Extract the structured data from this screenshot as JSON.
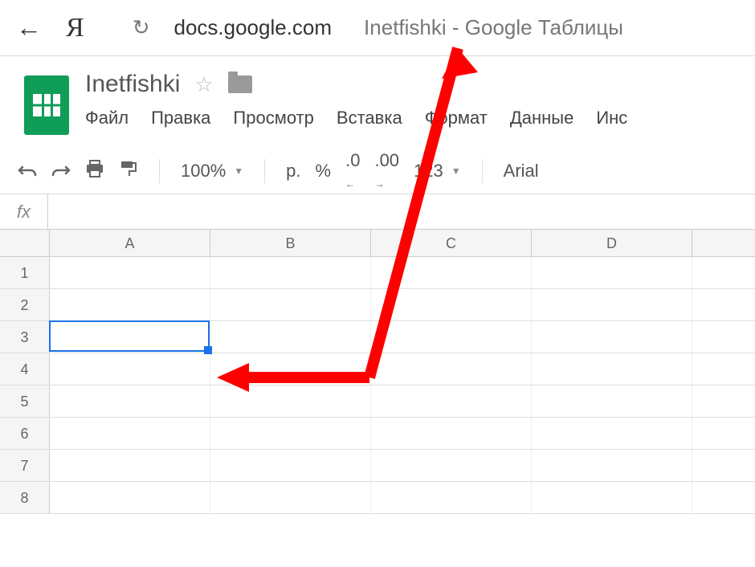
{
  "browser": {
    "back_icon": "←",
    "yandex_icon": "Я",
    "reload_icon": "↻",
    "url_domain": "docs.google.com",
    "url_title": "Inetfishki - Google Таблицы"
  },
  "doc": {
    "title": "Inetfishki",
    "star": "☆"
  },
  "menu": {
    "file": "Файл",
    "edit": "Правка",
    "view": "Просмотр",
    "insert": "Вставка",
    "format": "Формат",
    "data": "Данные",
    "tools": "Инс"
  },
  "toolbar": {
    "undo": "↶",
    "redo": "↷",
    "print": "🖨",
    "paint": "⬚",
    "zoom": "100%",
    "currency": "р.",
    "percent": "%",
    "dec_decrease": ".0",
    "dec_increase": ".00",
    "format_123": "123",
    "font": "Arial"
  },
  "formula": {
    "fx": "fx",
    "value": ""
  },
  "sheet": {
    "columns": [
      "A",
      "B",
      "C",
      "D"
    ],
    "rows": [
      "1",
      "2",
      "3",
      "4",
      "5",
      "6",
      "7",
      "8"
    ],
    "selected": {
      "row": 3,
      "col": "A"
    }
  }
}
